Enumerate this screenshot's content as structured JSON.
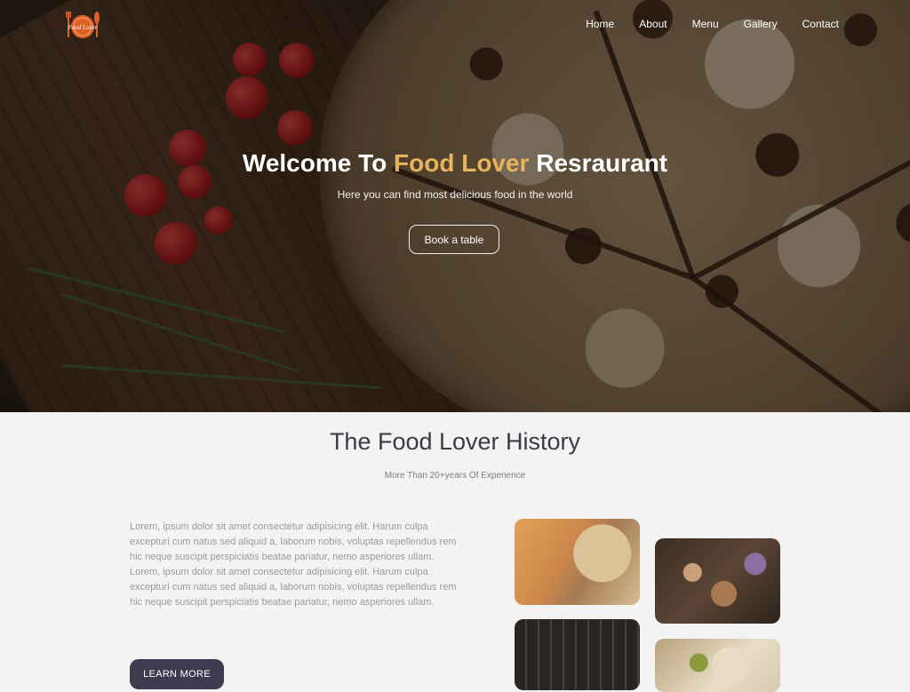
{
  "nav": {
    "items": [
      {
        "label": "Home"
      },
      {
        "label": "About"
      },
      {
        "label": "Menu"
      },
      {
        "label": "Gallery"
      },
      {
        "label": "Contact"
      }
    ]
  },
  "logo": {
    "text": "Food Lover"
  },
  "hero": {
    "title_prefix": "Welcome To ",
    "title_accent": "Food Lover",
    "title_suffix": " Resraurant",
    "subtitle": "Here you can find most delicious food in the world",
    "button_label": "Book a table"
  },
  "history": {
    "title": "The Food Lover History",
    "subtitle": "More Than 20+years Of Experience",
    "paragraphs": [
      "Lorem, ipsum dolor sit amet consectetur adipisicing elit. Harum culpa excepturi cum natus sed aliquid a, laborum nobis, voluptas repellendus rem hic neque suscipit perspiciatis beatae pariatur, nemo asperiores ullam.",
      "Lorem, ipsum dolor sit amet consectetur adipisicing elit. Harum culpa excepturi cum natus sed aliquid a, laborum nobis, voluptas repellendus rem hic neque suscipit perspiciatis beatae pariatur, nemo asperiores ullam."
    ],
    "button_label": "LEARN MORE"
  },
  "colors": {
    "accent": "#e7b45c",
    "logo": "#e0602a",
    "button_dark": "#3d3b4f",
    "title_dark": "#3b3a45"
  },
  "icons": {
    "logo": "restaurant-logo-icon"
  }
}
